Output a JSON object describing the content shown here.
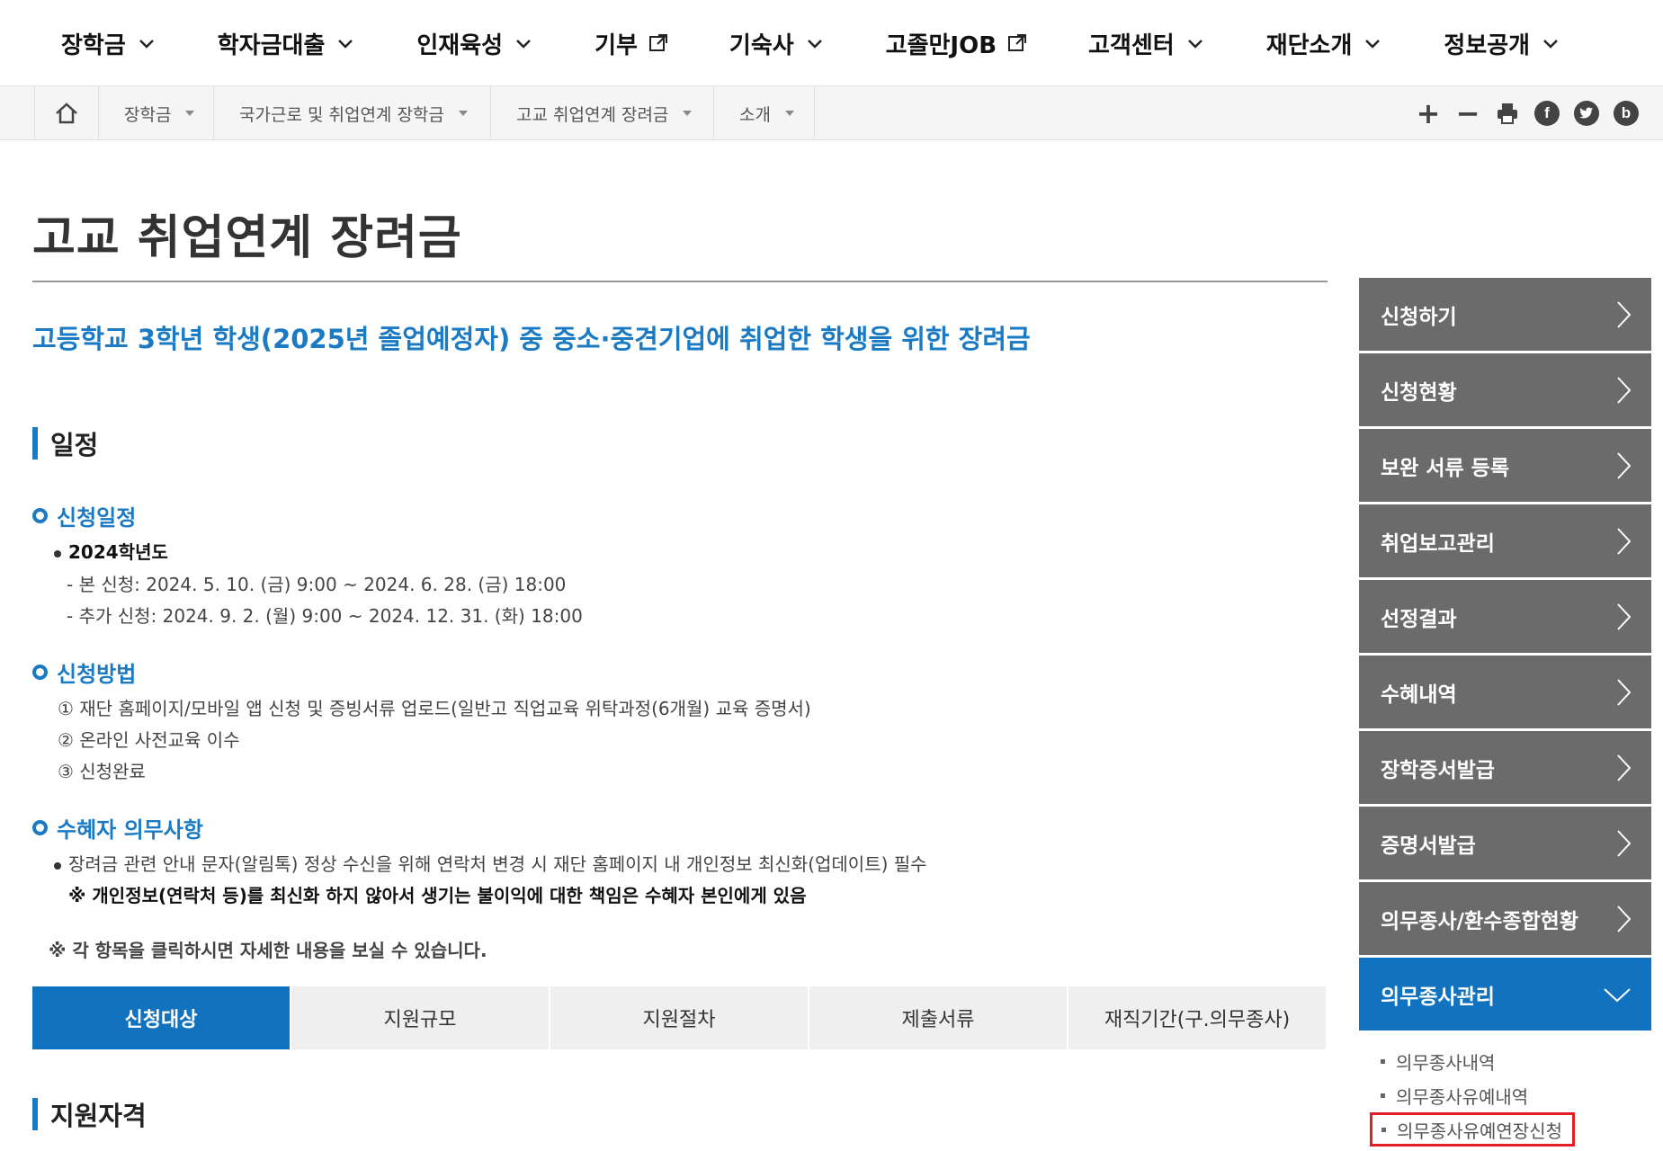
{
  "topnav": {
    "items": [
      {
        "label": "장학금",
        "icon": "chevron-down-icon"
      },
      {
        "label": "학자금대출",
        "icon": "chevron-down-icon"
      },
      {
        "label": "인재육성",
        "icon": "chevron-down-icon"
      },
      {
        "label": "기부",
        "icon": "external-link-icon"
      },
      {
        "label": "기숙사",
        "icon": "chevron-down-icon"
      },
      {
        "label": "고졸만JOB",
        "icon": "external-link-icon"
      },
      {
        "label": "고객센터",
        "icon": "chevron-down-icon"
      },
      {
        "label": "재단소개",
        "icon": "chevron-down-icon"
      },
      {
        "label": "정보공개",
        "icon": "chevron-down-icon"
      }
    ]
  },
  "breadcrumb": {
    "items": [
      "장학금",
      "국가근로 및 취업연계 장학금",
      "고교 취업연계 장려금",
      "소개"
    ]
  },
  "tools": {
    "zoom_in": "+",
    "zoom_out": "−",
    "facebook": "f",
    "blog": "b"
  },
  "page": {
    "title": "고교 취업연계 장려금",
    "subtitle": "고등학교 3학년 학생(2025년 졸업예정자) 중 중소·중견기업에 취업한 학생을 위한 장려금"
  },
  "schedule": {
    "heading": "일정",
    "apply_schedule": {
      "heading": "신청일정",
      "year": "2024학년도",
      "lines": [
        "- 본 신청: 2024. 5. 10. (금) 9:00 ~ 2024. 6. 28. (금) 18:00",
        "- 추가 신청: 2024. 9. 2. (월) 9:00 ~ 2024. 12. 31. (화) 18:00"
      ]
    },
    "apply_method": {
      "heading": "신청방법",
      "lines": [
        "① 재단 홈페이지/모바일 앱 신청 및 증빙서류 업로드(일반고 직업교육 위탁과정(6개월) 교육 증명서)",
        "② 온라인 사전교육 이수",
        "③ 신청완료"
      ]
    },
    "duties": {
      "heading": "수혜자 의무사항",
      "line": "장려금 관련 안내 문자(알림톡) 정상 수신을 위해 연락처 변경 시 재단 홈페이지 내 개인정보 최신화(업데이트) 필수",
      "warning": "※ 개인정보(연락처 등)를 최신화 하지 않아서 생기는 불이익에 대한 책임은 수혜자 본인에게 있음"
    },
    "note": "※ 각 항목을 클릭하시면 자세한 내용을 보실 수 있습니다."
  },
  "tabs": [
    "신청대상",
    "지원규모",
    "지원절차",
    "제출서류",
    "재직기간(구.의무종사)"
  ],
  "qualification": {
    "heading": "지원자격"
  },
  "sidemenu": {
    "items": [
      "신청하기",
      "신청현황",
      "보완 서류 등록",
      "취업보고관리",
      "선정결과",
      "수혜내역",
      "장학증서발급",
      "증명서발급",
      "의무종사/환수종합현황"
    ],
    "active": "의무종사관리",
    "subitems": [
      "의무종사내역",
      "의무종사유예내역",
      "의무종사유예연장신청"
    ]
  },
  "colors": {
    "accent": "#1173bf",
    "side_bg": "#6b6b6b",
    "highlight": "#e31e24"
  }
}
